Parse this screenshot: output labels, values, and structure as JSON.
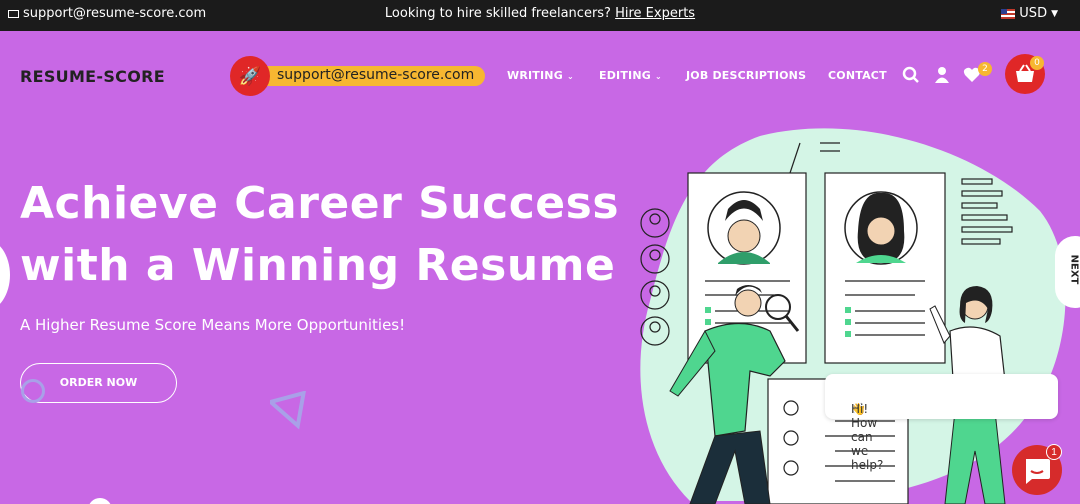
{
  "topbar": {
    "email": "support@resume-score.com",
    "promo_text": "Looking to hire skilled freelancers?",
    "promo_link": "Hire Experts",
    "currency": "USD"
  },
  "header": {
    "logo": "RESUME-SCORE",
    "support_email": "support@resume-score.com",
    "nav": [
      {
        "label": "WRITING"
      },
      {
        "label": "EDITING"
      },
      {
        "label": "JOB DESCRIPTIONS"
      },
      {
        "label": "CONTACT"
      }
    ],
    "wishlist_count": "2",
    "cart_count": "0"
  },
  "hero": {
    "headline_line1": "Achieve Career Success",
    "headline_line2": "with a Winning Resume",
    "subheadline": "A Higher Resume Score Means More Opportunities!",
    "cta": "ORDER NOW",
    "next_label": "NEXT"
  },
  "chat": {
    "greeting": "Hi! How can we help?",
    "emoji": "👋",
    "unread": "1"
  },
  "colors": {
    "hero_bg": "#c868e5",
    "accent_red": "#e02727",
    "accent_yellow": "#f7b731",
    "illustration_green": "#d4f5e6",
    "shirt_green": "#4fd68f"
  }
}
